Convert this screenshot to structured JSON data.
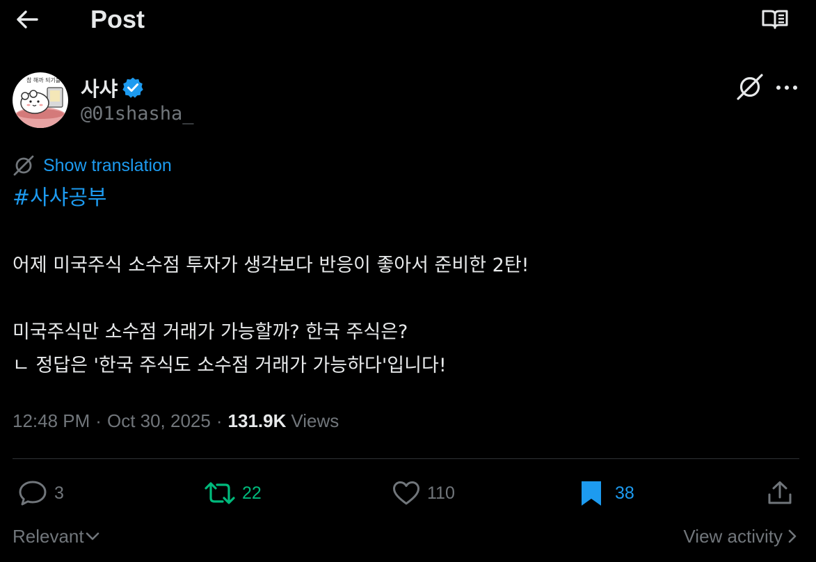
{
  "header": {
    "title": "Post",
    "back_icon": "arrow-left-icon",
    "reader_icon": "open-book-icon"
  },
  "author": {
    "name": "사샤",
    "handle": "@01shasha_",
    "verified": true,
    "avatar_icon": "cartoon-avatar",
    "avatar_text": "참 해까 되기를"
  },
  "translation": {
    "label": "Show translation",
    "icon": "translate-slash-icon"
  },
  "post": {
    "hashtag": "#사샤공부",
    "lines": [
      "어제 미국주식 소수점 투자가 생각보다 반응이 좋아서 준비한 2탄!",
      "미국주식만 소수점 거래가 가능할까? 한국 주식은?",
      "ㄴ 정답은 '한국 주식도 소수점 거래가 가능하다'입니다!"
    ]
  },
  "meta": {
    "time": "12:48 PM",
    "separator": "·",
    "date": "Oct 30, 2025",
    "views_count": "131.9K",
    "views_label": "Views"
  },
  "actions": {
    "replies": "3",
    "reposts": "22",
    "likes": "110",
    "bookmarks": "38"
  },
  "bottom": {
    "sort_label": "Relevant",
    "activity_label": "View activity"
  },
  "colors": {
    "background": "#000000",
    "text": "#e7e9ea",
    "muted": "#71767b",
    "accent": "#1d9bf0",
    "repost": "#00ba7c",
    "divider": "#2f3336"
  }
}
